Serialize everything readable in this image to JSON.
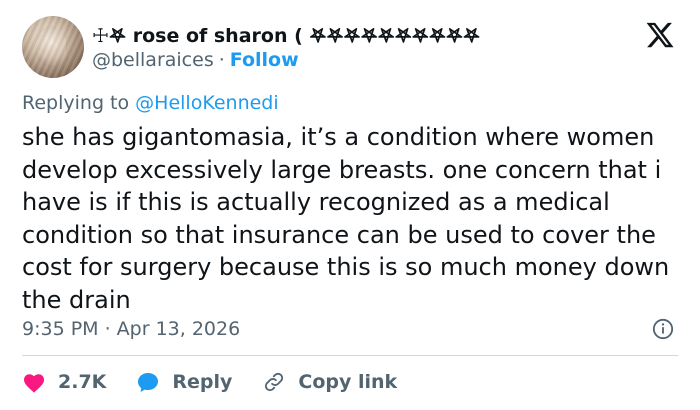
{
  "author": {
    "display_name": "☩𖤐 rose of sharon ( 𖤐𖤐𖤐𖤐𖤐𖤐𖤐𖤐𖤐𖤐",
    "handle": "@bellaraices",
    "separator": "·",
    "follow_label": "Follow"
  },
  "reply_context": {
    "prefix": "Replying to",
    "mention": "@HelloKennedi"
  },
  "tweet": {
    "text": "she has gigantomasia, it’s a condition where women develop excessively large breasts. one concern that i have is if this is actually recognized as a medical condition so that insurance can be used to cover the cost for surgery because this is so much money down the drain",
    "timestamp": "9:35 PM · Apr 13, 2026"
  },
  "actions": {
    "likes_count": "2.7K",
    "reply_label": "Reply",
    "copy_link_label": "Copy link"
  },
  "icons": {
    "logo": "x-logo-icon",
    "info": "info-icon",
    "heart": "heart-icon",
    "reply": "reply-bubble-icon",
    "link": "link-icon"
  },
  "colors": {
    "text": "#0f1419",
    "secondary": "#536471",
    "accent": "#1d9bf0",
    "like": "#f91880",
    "divider": "#cfd9de"
  }
}
